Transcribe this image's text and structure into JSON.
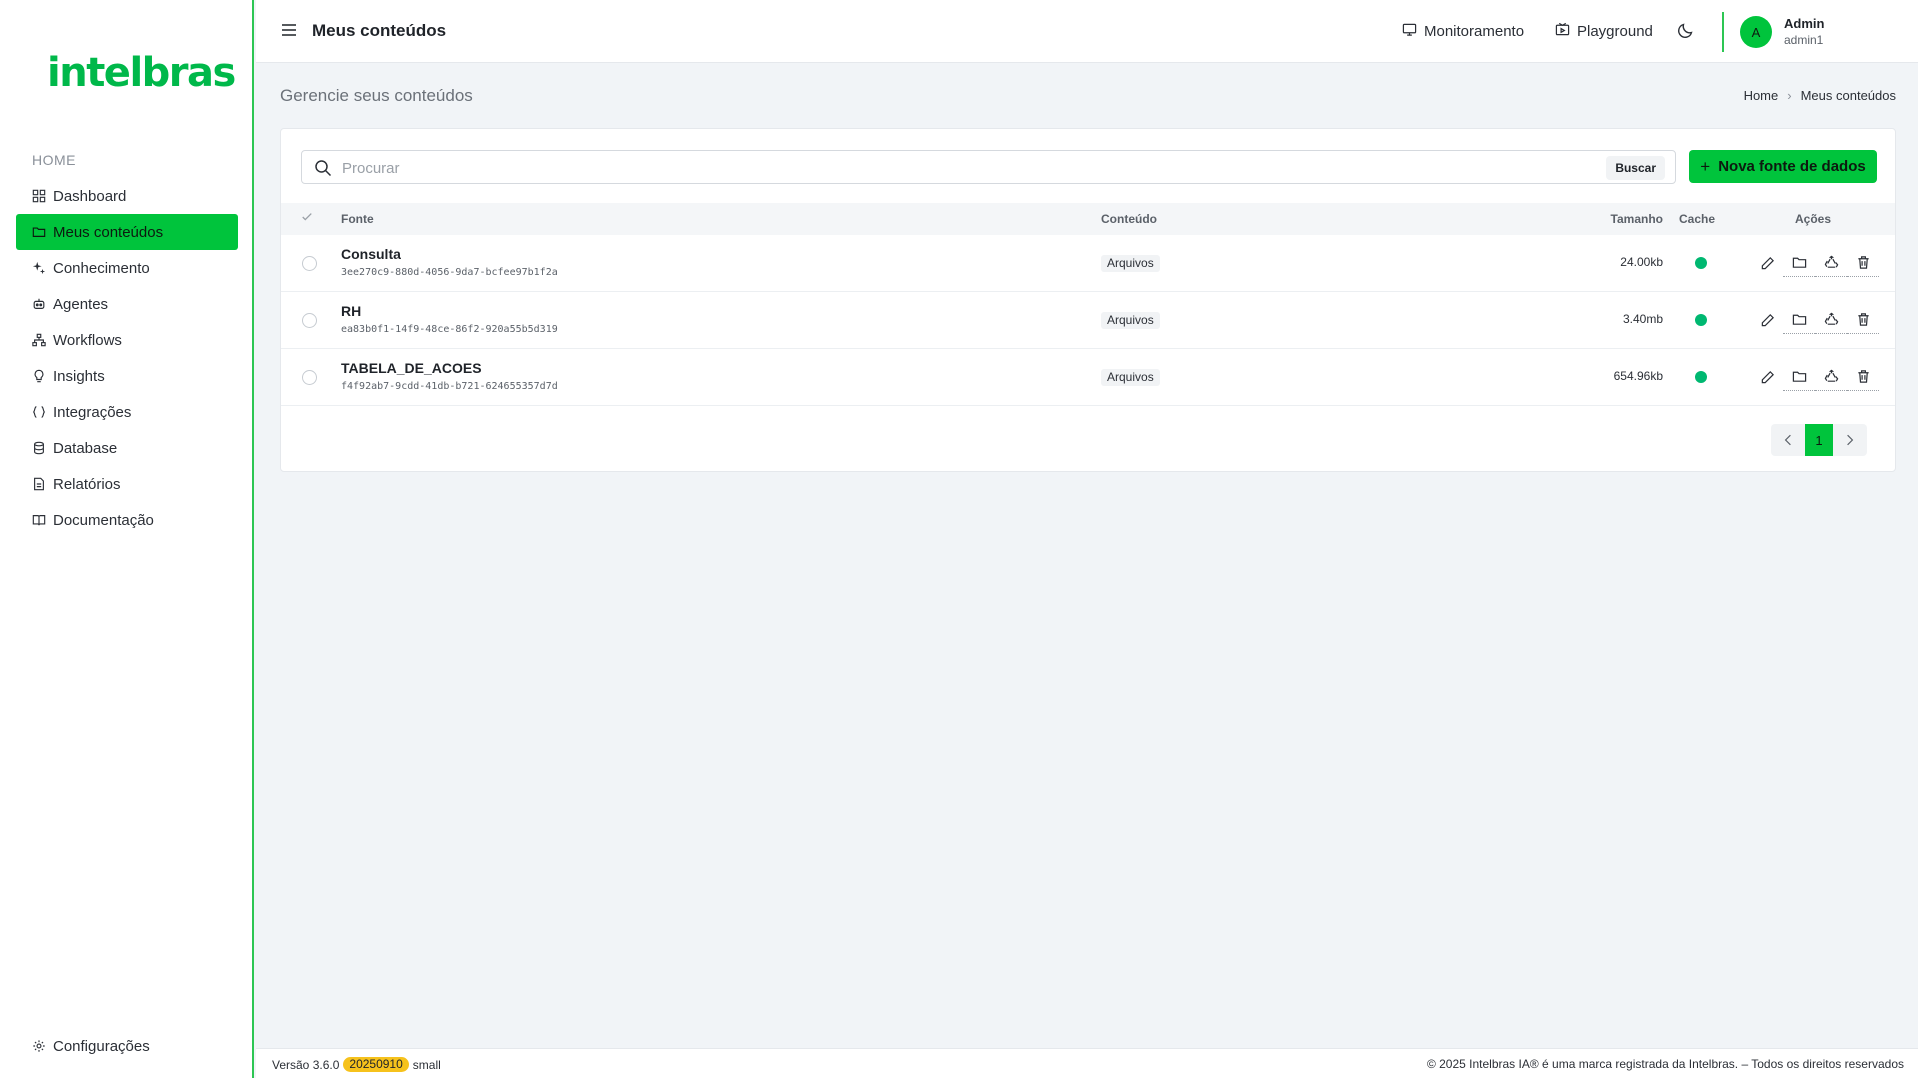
{
  "brand": {
    "logo_text": "intelbras",
    "accent": "#00c43c"
  },
  "sidebar": {
    "section": "HOME",
    "items": [
      {
        "label": "Dashboard",
        "icon": "grid-icon"
      },
      {
        "label": "Meus conteúdos",
        "icon": "folder-icon",
        "active": true
      },
      {
        "label": "Conhecimento",
        "icon": "sparkle-icon"
      },
      {
        "label": "Agentes",
        "icon": "robot-icon"
      },
      {
        "label": "Workflows",
        "icon": "sitemap-icon"
      },
      {
        "label": "Insights",
        "icon": "lightbulb-icon"
      },
      {
        "label": "Integrações",
        "icon": "braces-icon"
      },
      {
        "label": "Database",
        "icon": "database-icon"
      },
      {
        "label": "Relatórios",
        "icon": "report-icon"
      },
      {
        "label": "Documentação",
        "icon": "book-icon"
      }
    ],
    "settings_label": "Configurações"
  },
  "header": {
    "title": "Meus conteúdos",
    "monitoring": "Monitoramento",
    "playground": "Playground",
    "user": {
      "initial": "A",
      "name": "Admin",
      "login": "admin1"
    }
  },
  "page": {
    "subtitle": "Gerencie seus conteúdos",
    "breadcrumb": [
      "Home",
      "Meus conteúdos"
    ]
  },
  "search": {
    "placeholder": "Procurar",
    "value": "",
    "button": "Buscar"
  },
  "new_source_button": "Nova fonte de dados",
  "table": {
    "columns": {
      "source": "Fonte",
      "content": "Conteúdo",
      "size": "Tamanho",
      "cache": "Cache",
      "actions": "Ações"
    },
    "rows": [
      {
        "name": "Consulta",
        "id": "3ee270c9-880d-4056-9da7-bcfee97b1f2a",
        "content": "Arquivos",
        "size": "24.00kb",
        "cache": true
      },
      {
        "name": "RH",
        "id": "ea83b0f1-14f9-48ce-86f2-920a55b5d319",
        "content": "Arquivos",
        "size": "3.40mb",
        "cache": true
      },
      {
        "name": "TABELA_DE_ACOES",
        "id": "f4f92ab7-9cdd-41db-b721-624655357d7d",
        "content": "Arquivos",
        "size": "654.96kb",
        "cache": true
      }
    ]
  },
  "pagination": {
    "current": "1"
  },
  "footer": {
    "version": "Versão 3.6.0",
    "build": "20250910",
    "size": "small",
    "copyright": "© 2025 Intelbras IA® é uma marca registrada da Intelbras. – Todos os direitos reservados"
  }
}
